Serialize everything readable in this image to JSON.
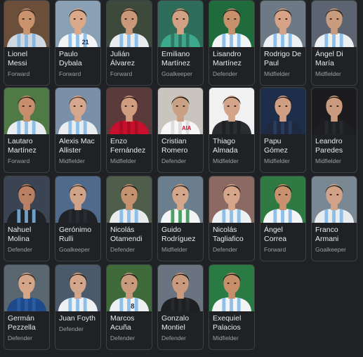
{
  "players": [
    {
      "name": "Lionel Messi",
      "position": "Forward"
    },
    {
      "name": "Paulo Dybala",
      "position": "Forward"
    },
    {
      "name": "Julián Álvarez",
      "position": "Forward"
    },
    {
      "name": "Emiliano Martínez",
      "position": "Goalkeeper"
    },
    {
      "name": "Lisandro Martínez",
      "position": "Defender"
    },
    {
      "name": "Rodrigo De Paul",
      "position": "Midfielder"
    },
    {
      "name": "Ángel Di María",
      "position": "Midfielder"
    },
    {
      "name": "Lautaro Martínez",
      "position": "Forward"
    },
    {
      "name": "Alexis Mac Allister",
      "position": "Midfielder"
    },
    {
      "name": "Enzo Fernández",
      "position": "Midfielder"
    },
    {
      "name": "Cristian Romero",
      "position": "Defender"
    },
    {
      "name": "Thiago Almada",
      "position": "Midfielder"
    },
    {
      "name": "Papu Gómez",
      "position": "Midfielder"
    },
    {
      "name": "Leandro Paredes",
      "position": "Midfielder"
    },
    {
      "name": "Nahuel Molina",
      "position": "Defender"
    },
    {
      "name": "Gerónimo Rulli",
      "position": "Goalkeeper"
    },
    {
      "name": "Nicolás Otamendi",
      "position": "Defender"
    },
    {
      "name": "Guido Rodríguez",
      "position": "Midfielder"
    },
    {
      "name": "Nicolás Tagliafico",
      "position": "Defender"
    },
    {
      "name": "Ángel Correa",
      "position": "Forward"
    },
    {
      "name": "Franco Armani",
      "position": "Goalkeeper"
    },
    {
      "name": "Germán Pezzella",
      "position": "Defender"
    },
    {
      "name": "Juan Foyth",
      "position": "Defender"
    },
    {
      "name": "Marcos Acuña",
      "position": "Defender"
    },
    {
      "name": "Gonzalo Montiel",
      "position": "Defender"
    },
    {
      "name": "Exequiel Palacios",
      "position": "Midfielder"
    }
  ],
  "photo_overlay_text": {
    "dybala_shirt_number": "21",
    "romero_shirt_text": "AIA",
    "acuna_shirt_number": "8"
  },
  "photo_palette": [
    {
      "bg": "#6b4f3a",
      "shirt": "#cfd8e0",
      "stripe": "#7fb0dc",
      "skin": "#c9936e",
      "hair": "#3a2a1e"
    },
    {
      "bg": "#8aa0b4",
      "shirt": "#f2f4f6",
      "stripe": "#7db6e6",
      "skin": "#d9a98a",
      "hair": "#2b201a"
    },
    {
      "bg": "#3d4a3b",
      "shirt": "#e8ecef",
      "stripe": "#7db6e6",
      "skin": "#c99879",
      "hair": "#2a1f18"
    },
    {
      "bg": "#2f6d5a",
      "shirt": "#3ea88c",
      "stripe": "#2f6d5a",
      "skin": "#d2a184",
      "hair": "#3b2b20"
    },
    {
      "bg": "#1f6b3c",
      "shirt": "#f3f4f5",
      "stripe": "#7db6e6",
      "skin": "#c7916e",
      "hair": "#1f1a16"
    },
    {
      "bg": "#6d7a86",
      "shirt": "#eef1f3",
      "stripe": "#7db6e6",
      "skin": "#d6a386",
      "hair": "#2e241c"
    },
    {
      "bg": "#5b6470",
      "shirt": "#eef1f3",
      "stripe": "#7db6e6",
      "skin": "#c99c7e",
      "hair": "#2a2019"
    },
    {
      "bg": "#4f7a45",
      "shirt": "#e9edf0",
      "stripe": "#7db6e6",
      "skin": "#c68e6a",
      "hair": "#1f1914"
    },
    {
      "bg": "#7a8fa8",
      "shirt": "#e9edf0",
      "stripe": "#7db6e6",
      "skin": "#d6a78c",
      "hair": "#4a3526"
    },
    {
      "bg": "#5a3a3a",
      "shirt": "#c8102e",
      "stripe": "#a30d25",
      "skin": "#cf9c7f",
      "hair": "#2a1f18"
    },
    {
      "bg": "#c9c4bd",
      "shirt": "#f6f6f6",
      "stripe": "#d8d8d8",
      "skin": "#caa085",
      "hair": "#1e1915"
    },
    {
      "bg": "#f1f1f1",
      "shirt": "#2a2c30",
      "stripe": "#1e2024",
      "skin": "#d3a489",
      "hair": "#1c1713"
    },
    {
      "bg": "#1d2d4a",
      "shirt": "#1f2a40",
      "stripe": "#2d3f60",
      "skin": "#cf9e83",
      "hair": "#2a1f18"
    },
    {
      "bg": "#1c1c1e",
      "shirt": "#1e1f22",
      "stripe": "#2a2b2f",
      "skin": "#c99a7e",
      "hair": "#1c1713"
    },
    {
      "bg": "#3a4452",
      "shirt": "#1f2226",
      "stripe": "#7db6e6",
      "skin": "#b98063",
      "hair": "#1e1915"
    },
    {
      "bg": "#4f6a8a",
      "shirt": "#1f2226",
      "stripe": "#2a2d32",
      "skin": "#d0a287",
      "hair": "#3a2a1e"
    },
    {
      "bg": "#4f5e4a",
      "shirt": "#e8ecef",
      "stripe": "#7db6e6",
      "skin": "#c4926f",
      "hair": "#1f1914"
    },
    {
      "bg": "#6a7e8e",
      "shirt": "#f3f4f5",
      "stripe": "#2f8f4a",
      "skin": "#d3a58a",
      "hair": "#2e241c"
    },
    {
      "bg": "#8a6a62",
      "shirt": "#eef1f3",
      "stripe": "#7db6e6",
      "skin": "#d6a68a",
      "hair": "#2a1f18"
    },
    {
      "bg": "#2f7a42",
      "shirt": "#f3f4f5",
      "stripe": "#7db6e6",
      "skin": "#c9926e",
      "hair": "#1f1914"
    },
    {
      "bg": "#7a8894",
      "shirt": "#e8ecef",
      "stripe": "#7db6e6",
      "skin": "#d1a287",
      "hair": "#2a2019"
    },
    {
      "bg": "#5a6670",
      "shirt": "#1e4a8a",
      "stripe": "#2d5fa8",
      "skin": "#d4a589",
      "hair": "#3a2a1e"
    },
    {
      "bg": "#4a5a6a",
      "shirt": "#eef1f3",
      "stripe": "#7db6e6",
      "skin": "#d3a58a",
      "hair": "#2a1f18"
    },
    {
      "bg": "#3f6b3a",
      "shirt": "#eef1f3",
      "stripe": "#7db6e6",
      "skin": "#c99a7c",
      "hair": "#1f1914"
    },
    {
      "bg": "#6a7480",
      "shirt": "#1e1f22",
      "stripe": "#2a2b2f",
      "skin": "#c99a7e",
      "hair": "#1c1713"
    },
    {
      "bg": "#2a7a44",
      "shirt": "#f3f4f5",
      "stripe": "#7db6e6",
      "skin": "#c68e6a",
      "hair": "#1c1713"
    }
  ]
}
